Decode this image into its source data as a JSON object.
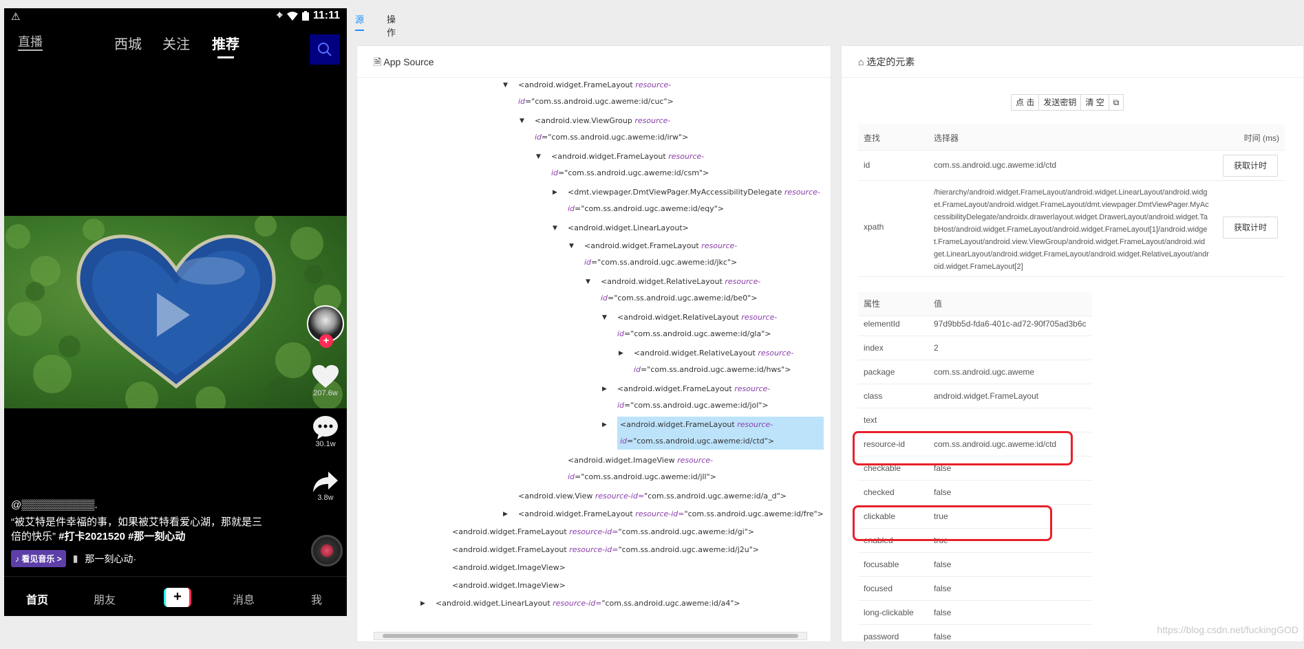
{
  "phone": {
    "status": {
      "time": "11:11"
    },
    "top_nav": {
      "live": "直播",
      "tabs": [
        "西城",
        "关注",
        "推荐"
      ]
    },
    "actions": {
      "likes": "207.6w",
      "comments": "30.1w",
      "shares": "3.8w"
    },
    "caption": {
      "author": "@▒▒▒▒▒▒▒▒▒▒.",
      "line1": "“被艾特是件幸福的事，如果被艾特看爱心湖，那就是三",
      "line2_prefix": "倍的快乐”",
      "hashtags": "#打卡2021520  #那一刻心动"
    },
    "music": {
      "badge": "♪ 看见音乐 >",
      "track": "那一刻心动·"
    },
    "bottom_nav": {
      "home": "首页",
      "friends": "朋友",
      "plus": "+",
      "messages": "消息",
      "me": "我"
    }
  },
  "inspector": {
    "tabs": [
      "源",
      "操作"
    ],
    "source_title": "App Source",
    "selected_title": "选定的元素",
    "buttons": [
      "点 击",
      "发送密钥",
      "清 空",
      "⧉"
    ],
    "find_table": {
      "headers": [
        "查找",
        "选择器",
        "时间 (ms)"
      ],
      "rows": [
        {
          "key": "id",
          "value": "com.ss.android.ugc.aweme:id/ctd",
          "button": "获取计时"
        },
        {
          "key": "xpath",
          "value": "/hierarchy/android.widget.FrameLayout/android.widget.LinearLayout/android.widget.FrameLayout/android.widget.FrameLayout/dmt.viewpager.DmtViewPager.MyAccessibilityDelegate/androidx.drawerlayout.widget.DrawerLayout/android.widget.TabHost/android.widget.FrameLayout/android.widget.FrameLayout[1]/android.widget.FrameLayout/android.view.ViewGroup/android.widget.FrameLayout/android.widget.LinearLayout/android.widget.FrameLayout/android.widget.RelativeLayout/android.widget.FrameLayout[2]",
          "button": "获取计时"
        }
      ]
    },
    "attr_table": {
      "headers": [
        "属性",
        "值"
      ],
      "rows": [
        {
          "k": "elementId",
          "v": "97d9bb5d-fda6-401c-ad72-90f705ad3b6c"
        },
        {
          "k": "index",
          "v": "2"
        },
        {
          "k": "package",
          "v": "com.ss.android.ugc.aweme"
        },
        {
          "k": "class",
          "v": "android.widget.FrameLayout"
        },
        {
          "k": "text",
          "v": ""
        },
        {
          "k": "resource-id",
          "v": "com.ss.android.ugc.aweme:id/ctd"
        },
        {
          "k": "checkable",
          "v": "false"
        },
        {
          "k": "checked",
          "v": "false"
        },
        {
          "k": "clickable",
          "v": "true"
        },
        {
          "k": "enabled",
          "v": "true"
        },
        {
          "k": "focusable",
          "v": "false"
        },
        {
          "k": "focused",
          "v": "false"
        },
        {
          "k": "long-clickable",
          "v": "false"
        },
        {
          "k": "password",
          "v": "false"
        }
      ]
    },
    "tree": [
      {
        "tag": "<android.widget.FrameLayout",
        "attr": "resource-",
        "id": "id=\"com.ss.android.ugc.aweme:id/cuc\">",
        "caret": "▼"
      },
      {
        "tag": "<android.view.ViewGroup",
        "attr": "resource-",
        "id": "id=\"com.ss.android.ugc.aweme:id/irw\">",
        "caret": "▼"
      },
      {
        "tag": "<android.widget.FrameLayout",
        "attr": "resource-",
        "id": "id=\"com.ss.android.ugc.aweme:id/csm\">",
        "caret": "▼"
      },
      {
        "tag": "<dmt.viewpager.DmtViewPager.MyAccessibilityDelegate",
        "attr": "resource-",
        "id": "id=\"com.ss.android.ugc.aweme:id/eqy\">",
        "caret": "▶"
      },
      {
        "tag": "<android.widget.LinearLayout>",
        "attr": "",
        "id": "",
        "caret": "▼"
      },
      {
        "tag": "<android.widget.FrameLayout",
        "attr": "resource-",
        "id": "id=\"com.ss.android.ugc.aweme:id/jkc\">",
        "caret": "▼"
      },
      {
        "tag": "<android.widget.RelativeLayout",
        "attr": "resource-",
        "id": "id=\"com.ss.android.ugc.aweme:id/be0\">",
        "caret": "▼"
      },
      {
        "tag": "<android.widget.RelativeLayout",
        "attr": "resource-",
        "id": "id=\"com.ss.android.ugc.aweme:id/gla\">",
        "caret": "▼"
      },
      {
        "tag": "<android.widget.RelativeLayout",
        "attr": "resource-",
        "id": "id=\"com.ss.android.ugc.aweme:id/hws\">",
        "caret": "▶"
      },
      {
        "tag": "<android.widget.FrameLayout",
        "attr": "resource-",
        "id": "id=\"com.ss.android.ugc.aweme:id/jol\">",
        "caret": "▶"
      },
      {
        "tag": "<android.widget.FrameLayout",
        "attr": "resource-",
        "id": "id=\"com.ss.android.ugc.aweme:id/ctd\">",
        "caret": "▶"
      },
      {
        "tag": "<android.widget.ImageView",
        "attr": "resource-",
        "id": "id=\"com.ss.android.ugc.aweme:id/jll\">",
        "caret": ""
      },
      {
        "tag": "<android.view.View",
        "attr": "resource-id=",
        "id": "\"com.ss.android.ugc.aweme:id/a_d\">",
        "caret": ""
      },
      {
        "tag": "<android.widget.FrameLayout",
        "attr": "resource-id=",
        "id": "\"com.ss.android.ugc.aweme:id/fre\">",
        "caret": "▶"
      },
      {
        "tag": "<android.widget.FrameLayout",
        "attr": "resource-id=",
        "id": "\"com.ss.android.ugc.aweme:id/gi\">",
        "caret": ""
      },
      {
        "tag": "<android.widget.FrameLayout",
        "attr": "resource-id=",
        "id": "\"com.ss.android.ugc.aweme:id/j2u\">",
        "caret": ""
      },
      {
        "tag": "<android.widget.ImageView>",
        "attr": "",
        "id": "",
        "caret": ""
      },
      {
        "tag": "<android.widget.ImageView>",
        "attr": "",
        "id": "",
        "caret": ""
      },
      {
        "tag": "<android.widget.LinearLayout",
        "attr": "resource-id=",
        "id": "\"com.ss.android.ugc.aweme:id/a4\">",
        "caret": "▶"
      }
    ]
  },
  "watermark": "https://blog.csdn.net/fuckingGOD"
}
